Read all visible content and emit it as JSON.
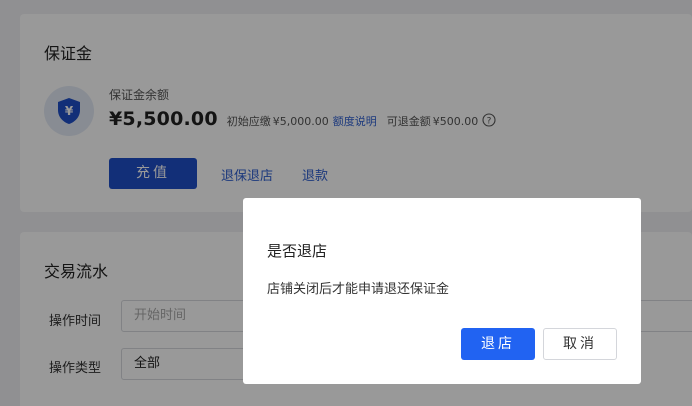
{
  "deposit": {
    "title": "保证金",
    "balance_label": "保证金余额",
    "balance_amount": "¥5,500.00",
    "initial_due_label": "初始应缴",
    "initial_due_value": "¥5,000.00",
    "quota_link": "额度说明",
    "refundable_label": "可退金额",
    "refundable_value": "¥500.00",
    "help_icon": "question-circle-icon",
    "shield_icon": "yuan-shield-icon",
    "recharge_label": "充值",
    "refund_shop_link": "退保退店",
    "refund_link": "退款"
  },
  "flow": {
    "title": "交易流水",
    "time_label": "操作时间",
    "time_placeholder": "开始时间",
    "type_label": "操作类型",
    "type_value": "全部"
  },
  "dialog": {
    "title": "是否退店",
    "message": "店铺关闭后才能申请退还保证金",
    "confirm_label": "退店",
    "cancel_label": "取消"
  },
  "colors": {
    "primary": "#1e4fc9",
    "dialog_primary": "#2163f2",
    "link": "#2f5fd0",
    "overlay": "rgba(0,0,0,0.40)"
  }
}
